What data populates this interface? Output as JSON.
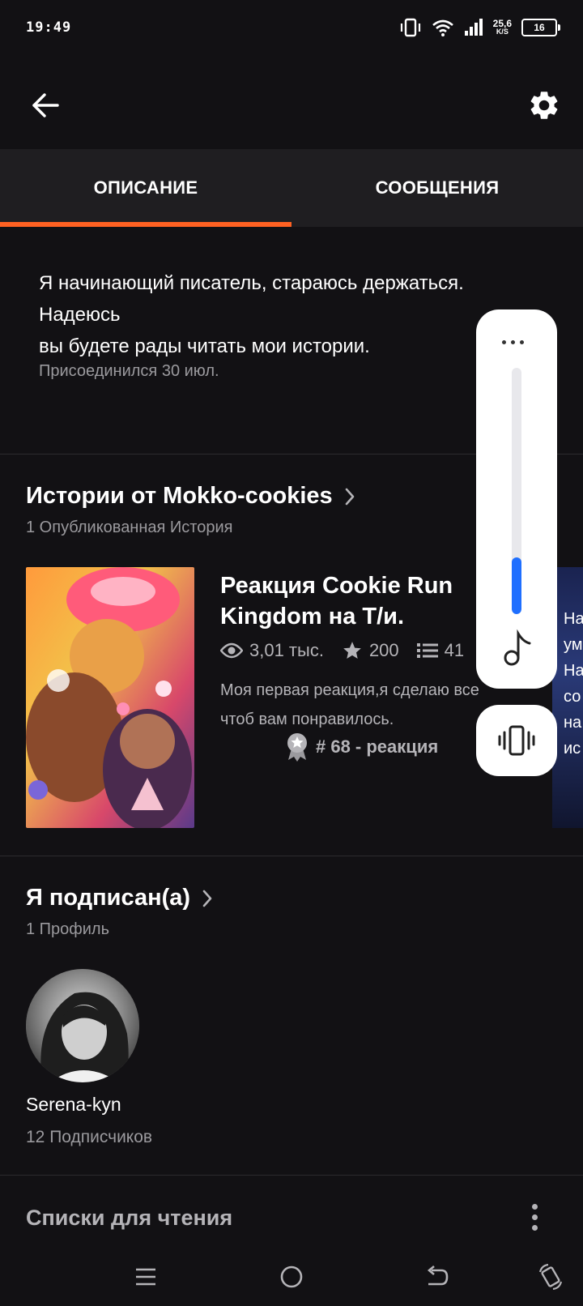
{
  "status_bar": {
    "time": "19:49",
    "net_speed": "25,6",
    "net_speed_unit": "K/S",
    "battery": "16"
  },
  "app_bar": {
    "back_icon": "arrow-left-icon",
    "settings_icon": "gear-icon"
  },
  "tabs": [
    {
      "label": "ОПИСАНИЕ",
      "active": true
    },
    {
      "label": "СООБЩЕНИЯ",
      "active": false
    }
  ],
  "about": {
    "text": "Я начинающий писатель, стараюсь держаться.\nНадеюсь\nвы будете рады читать мои истории.",
    "joined": "Присоединился 30 июл."
  },
  "stories": {
    "title": "Истории от Mokko-cookies",
    "subtitle": "1 Опубликованная История",
    "items": [
      {
        "title": "Реакция Cookie Run Kingdom на Т/и.",
        "views": "3,01 тыс.",
        "votes": "200",
        "parts": "41",
        "description": "Моя первая реакция,я сделаю все чтоб вам понравилось.",
        "rank": "# 68 - реакция"
      }
    ],
    "next_cover_text": [
      "На",
      "ум",
      "На",
      "со",
      "на",
      "ис"
    ]
  },
  "following": {
    "title": "Я подписан(а)",
    "subtitle": "1 Профиль",
    "profiles": [
      {
        "name": "Serena-kyn",
        "followers": "12 Подписчиков"
      }
    ]
  },
  "reading_lists": {
    "title": "Списки для чтения"
  },
  "volume_overlay": {
    "level": 0.23,
    "accent": "#1f6fff"
  },
  "colors": {
    "accent": "#ff6122",
    "background": "#121114",
    "tab_background": "#1f1e21"
  }
}
